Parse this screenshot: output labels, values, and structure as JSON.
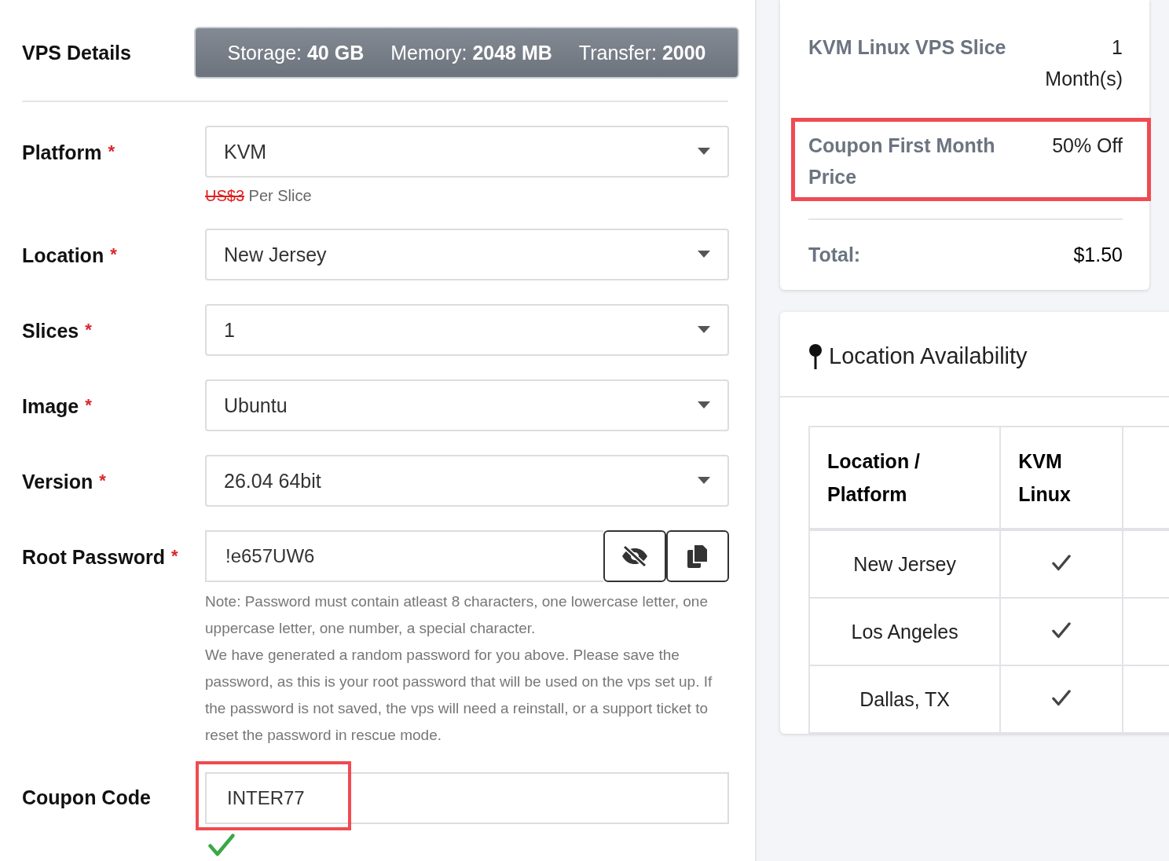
{
  "vps_details": {
    "label": "VPS Details",
    "specs": [
      {
        "name": "Storage:",
        "value": "40 GB"
      },
      {
        "name": "Memory:",
        "value": "2048 MB"
      },
      {
        "name": "Transfer:",
        "value": "2000"
      }
    ]
  },
  "fields": [
    {
      "kind": "select",
      "label": "Platform",
      "required_mark": "*",
      "value": "KVM",
      "price": {
        "old": "US$3",
        "unit": "Per Slice"
      }
    },
    {
      "kind": "select",
      "label": "Location",
      "required_mark": "*",
      "value": "New Jersey"
    },
    {
      "kind": "select",
      "label": "Slices",
      "required_mark": "*",
      "value": "1"
    },
    {
      "kind": "select",
      "label": "Image",
      "required_mark": "*",
      "value": "Ubuntu"
    },
    {
      "kind": "select",
      "label": "Version",
      "required_mark": "*",
      "value": "26.04 64bit"
    },
    {
      "kind": "password",
      "label": "Root Password",
      "required_mark": "*",
      "value": "!e657UW6",
      "notes": [
        "Note: Password must contain atleast 8 characters, one lowercase letter, one uppercase letter, one number, a special character.",
        "We have generated a random password for you above. Please save the password, as this is your root password that will be used on the vps set up. If the password is not saved, the vps will need a reinstall, or a support ticket to reset the password in rescue mode."
      ]
    },
    {
      "kind": "coupon",
      "label": "Coupon Code",
      "value": "INTER77",
      "highlighted": true,
      "valid": true
    }
  ],
  "summary": {
    "items": [
      {
        "label": "KVM Linux VPS Slice",
        "value": "1 Month(s)",
        "highlighted": false
      },
      {
        "label": "Coupon First Month Price",
        "value": "50% Off",
        "highlighted": true
      }
    ],
    "total": {
      "label": "Total:",
      "value": "$1.50"
    }
  },
  "availability": {
    "title": "Location Availability",
    "columns": [
      "Location / Platform",
      "KVM Linux"
    ],
    "rows": [
      {
        "location": "New Jersey",
        "available": [
          true
        ]
      },
      {
        "location": "Los Angeles",
        "available": [
          true
        ]
      },
      {
        "location": "Dallas, TX",
        "available": [
          true
        ]
      }
    ]
  }
}
